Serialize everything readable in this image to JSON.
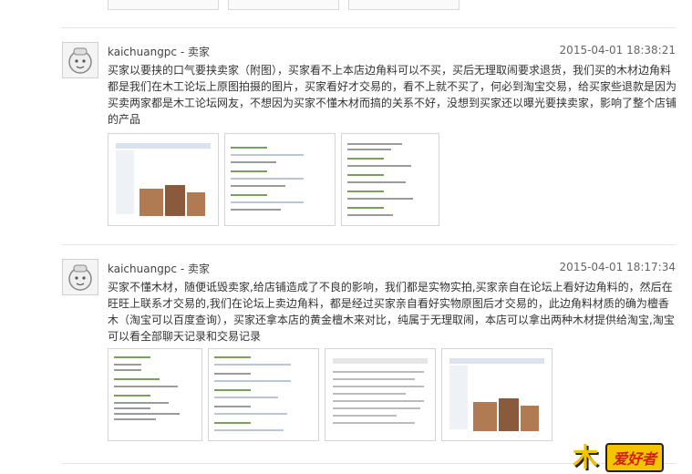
{
  "post1": {
    "user": "kaichuangpc - 卖家",
    "time": "2015-04-01 18:38:21",
    "avatar_label": "卖家秀",
    "text": "买家以要挟的口气要挟卖家（附图），买家看不上本店边角料可以不买，买后无理取闹要求退货，我们买的木材边角料都是我们在木工论坛上原图拍摄的图片，买家看好才交易的，看不上就不买了，何必到淘宝交易，给买家些退款是因为买卖两家都是木工论坛网友，不想因为买家不懂木材而搞的关系不好，没想到买家还以曝光要挟卖家，影响了整个店铺的产品",
    "images": [
      {
        "label": "post1-screenshot-image"
      },
      {
        "label": "post1-chat-image-1"
      },
      {
        "label": "post1-chat-image-2"
      }
    ]
  },
  "post2": {
    "user": "kaichuangpc - 卖家",
    "time": "2015-04-01 18:17:34",
    "avatar_label": "卖家秀",
    "text": "买家不懂木材，随便诋毁卖家,给店铺造成了不良的影响，我们都是实物实拍,买家亲自在论坛上看好边角料的，然后在旺旺上联系才交易的,我们在论坛上卖边角料，都是经过买家亲自看好实物原图后才交易的，此边角料材质的确为檀香木（淘宝可以百度查询），买家还拿本店的黄金檀木来对比，纯属于无理取闹，本店可以拿出两种木材提供给淘宝,淘宝可以看全部聊天记录和交易记录",
    "images": [
      {
        "label": "post2-chat-image-1"
      },
      {
        "label": "post2-chat-image-2"
      },
      {
        "label": "post2-document-image"
      },
      {
        "label": "post2-screenshot-image"
      }
    ]
  },
  "watermark": {
    "glyph": "木",
    "text": "爱好者"
  }
}
